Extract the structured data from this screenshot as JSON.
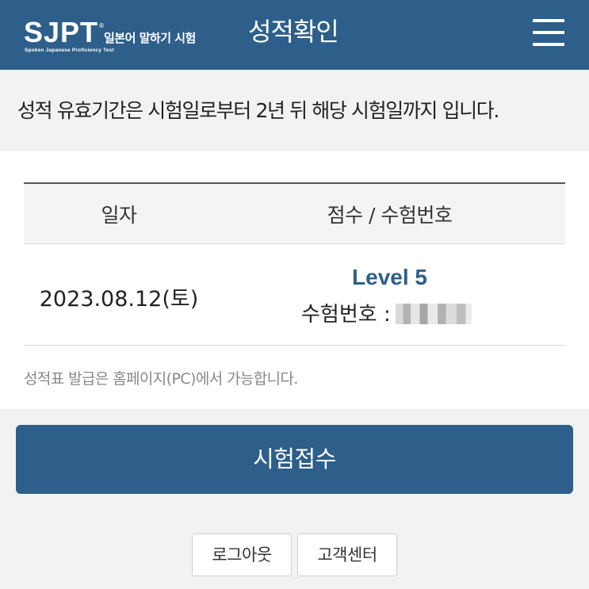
{
  "header": {
    "logo_main": "SJPT",
    "logo_reg": "®",
    "logo_kr": "일본어 말하기 시험",
    "logo_en": "Spoken Japanese Proficiency Test",
    "title": "성적확인",
    "menu_icon": "hamburger-menu-icon"
  },
  "notice": {
    "text": "성적 유효기간은 시험일로부터 2년 뒤 해당 시험일까지 입니다."
  },
  "table": {
    "headers": [
      "일자",
      "점수 / 수험번호"
    ],
    "rows": [
      {
        "date": "2023.08.12(토)",
        "level": "Level 5",
        "exam_label": "수험번호 :"
      }
    ]
  },
  "issue_note": "성적표 발급은 홈페이지(PC)에서 가능합니다.",
  "buttons": {
    "apply": "시험접수",
    "logout": "로그아웃",
    "customer_center": "고객센터"
  },
  "colors": {
    "primary": "#2d5f8a",
    "background": "#f2f2f2",
    "card": "#ffffff"
  }
}
